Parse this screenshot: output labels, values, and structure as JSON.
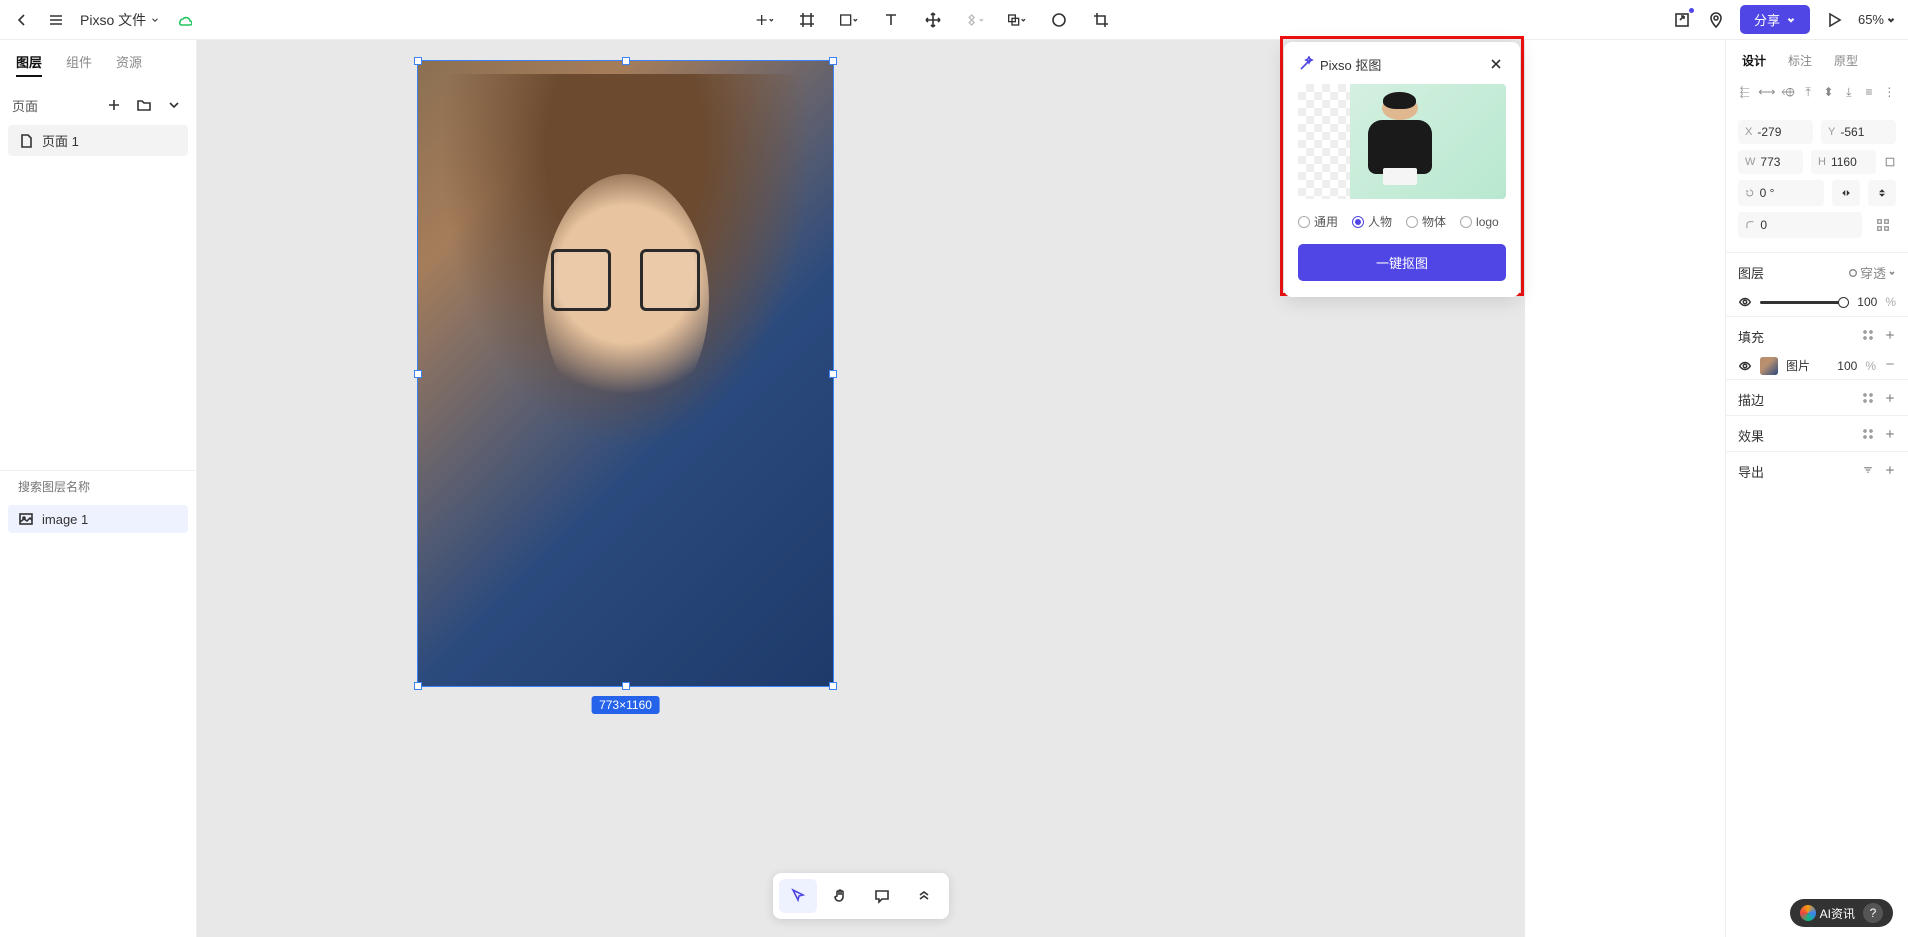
{
  "topbar": {
    "file_name": "Pixso 文件",
    "share_label": "分享",
    "zoom": "65%"
  },
  "left_panel": {
    "tabs": [
      "图层",
      "组件",
      "资源"
    ],
    "active_tab": 0,
    "pages_label": "页面",
    "pages": [
      {
        "label": "页面 1"
      }
    ],
    "search_placeholder": "搜索图层名称",
    "layers": [
      {
        "label": "image 1"
      }
    ]
  },
  "canvas": {
    "dimension_label": "773×1160"
  },
  "popup": {
    "title": "Pixso 抠图",
    "options": [
      "通用",
      "人物",
      "物体",
      "logo"
    ],
    "selected_option": 1,
    "button_label": "一键抠图"
  },
  "right_panel": {
    "tabs": [
      "设计",
      "标注",
      "原型"
    ],
    "active_tab": 0,
    "position": {
      "x_label": "X",
      "x_value": "-279",
      "y_label": "Y",
      "y_value": "-561"
    },
    "size": {
      "w_label": "W",
      "w_value": "773",
      "h_label": "H",
      "h_value": "1160"
    },
    "rotation": {
      "label": "",
      "value": "0 °"
    },
    "radius": {
      "label": "",
      "value": "0"
    },
    "layer_section": "图层",
    "layer_mode": "穿透",
    "opacity": "100",
    "opacity_unit": "%",
    "fill_section": "填充",
    "fill_label": "图片",
    "fill_opacity": "100",
    "fill_unit": "%",
    "stroke_section": "描边",
    "effect_section": "效果",
    "export_section": "导出"
  },
  "watermark": {
    "label": "AI资讯",
    "help": "?"
  }
}
